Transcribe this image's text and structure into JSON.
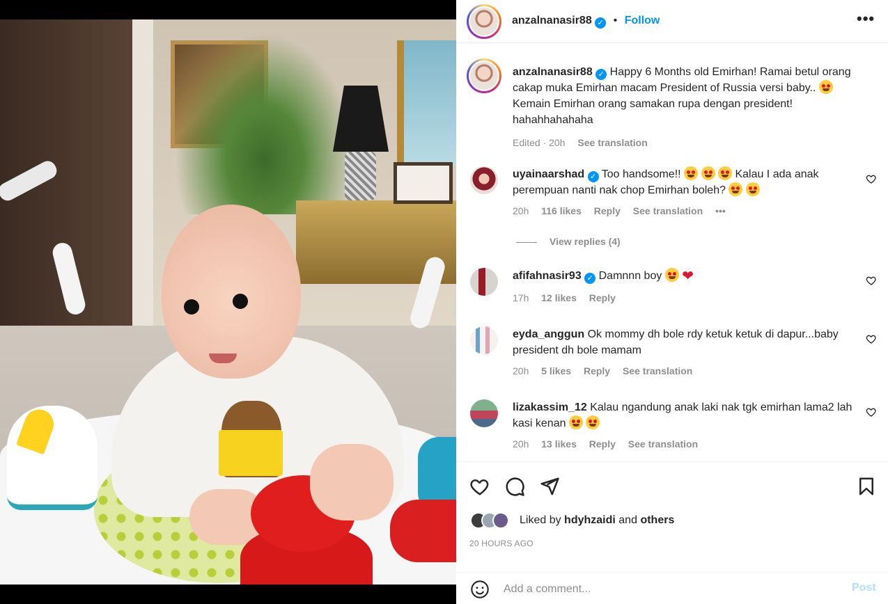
{
  "post": {
    "author": "anzalnanasir88",
    "verified_mark": "✓",
    "separator": "•",
    "follow_label": "Follow",
    "more_label": "•••"
  },
  "caption": {
    "username": "anzalnanasir88",
    "text_part1": "Happy 6 Months old Emirhan! Ramai betul orang cakap muka Emirhan macam President of Russia versi baby..",
    "text_part2": "Kemain Emirhan orang samakan rupa dengan president! hahahhahahaha",
    "edited": "Edited · 20h",
    "see_translation": "See translation"
  },
  "comments": [
    {
      "username": "uyainaarshad",
      "verified": true,
      "text_a": "Too handsome!!",
      "text_b": "Kalau I ada anak perempuan nanti nak chop Emirhan boleh?",
      "time": "20h",
      "likes": "116 likes",
      "reply": "Reply",
      "see_translation": "See translation",
      "more": "•••"
    },
    {
      "username": "afifahnasir93",
      "verified": true,
      "text_a": "Damnnn boy",
      "time": "17h",
      "likes": "12 likes",
      "reply": "Reply"
    },
    {
      "username": "eyda_anggun",
      "verified": false,
      "text_a": "Ok mommy dh bole rdy ketuk ketuk di dapur...baby president dh bole mamam",
      "time": "20h",
      "likes": "5 likes",
      "reply": "Reply",
      "see_translation": "See translation"
    },
    {
      "username": "lizakassim_12",
      "verified": false,
      "text_a": "Kalau ngandung anak laki nak tgk emirhan lama2 lah kasi kenan",
      "time": "20h",
      "likes": "13 likes",
      "reply": "Reply",
      "see_translation": "See translation"
    }
  ],
  "view_replies": "View replies (4)",
  "likes": {
    "prefix": "Liked by",
    "user": "hdyhzaidi",
    "and": "and",
    "others": "others"
  },
  "time_ago": "20 HOURS AGO",
  "comment_box": {
    "placeholder": "Add a comment...",
    "post_label": "Post"
  },
  "icons": {
    "like": "heart-icon",
    "comment": "comment-icon",
    "share": "share-icon",
    "save": "bookmark-icon",
    "emoji": "smiley-icon"
  },
  "colors": {
    "link": "#0095f6",
    "secondary_text": "#8e8e8e",
    "post_disabled": "#b2dffc"
  }
}
